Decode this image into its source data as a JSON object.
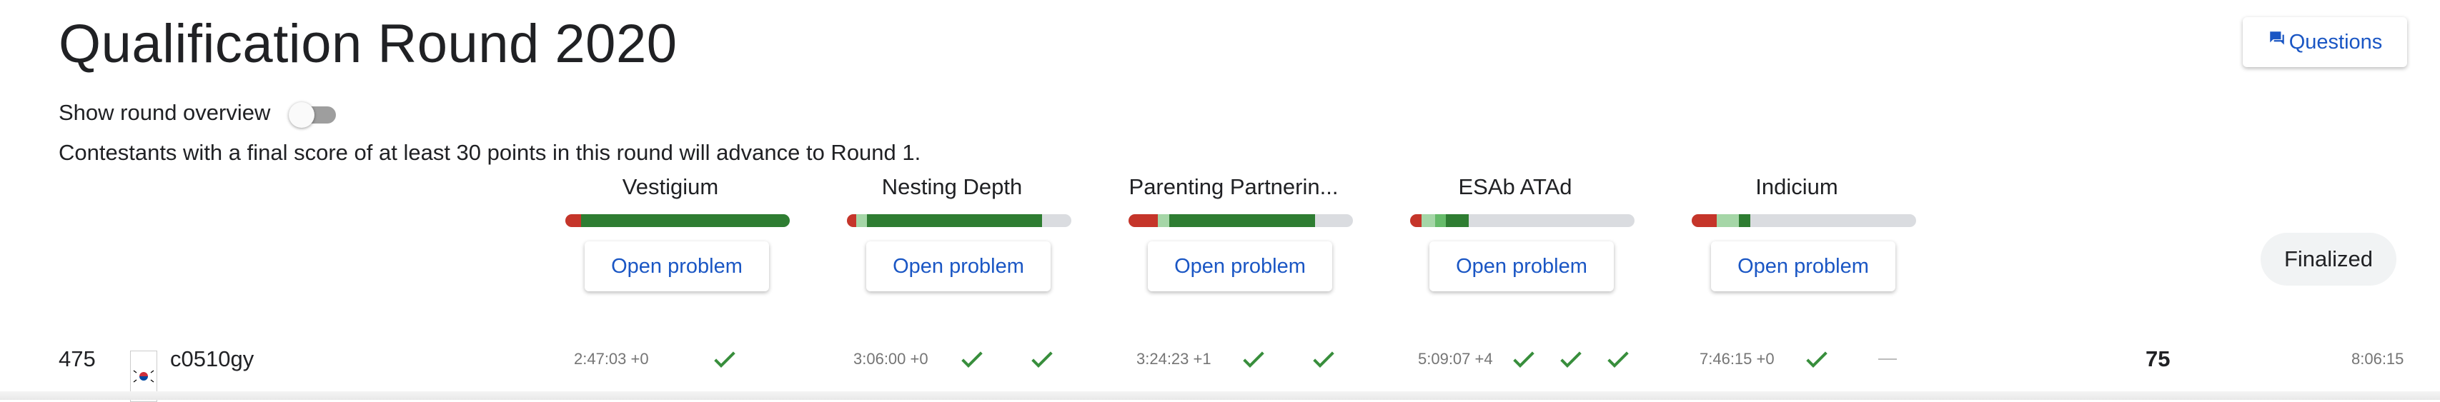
{
  "round": {
    "title": "Qualification Round 2020",
    "questions_label": "Questions",
    "overview_toggle_label": "Show round overview",
    "overview_toggle_on": false,
    "advance_text": "Contestants with a final score of at least 30 points in this round will advance to Round 1.",
    "status_label": "Finalized",
    "open_problem_label": "Open problem"
  },
  "problems": [
    {
      "name": "Vestigium",
      "bar": [
        {
          "color": "#c5352a",
          "frac": 0.07
        },
        {
          "color": "#2e7d32",
          "frac": 0.93
        }
      ]
    },
    {
      "name": "Nesting Depth",
      "bar": [
        {
          "color": "#c5352a",
          "frac": 0.04
        },
        {
          "color": "#a5d6a7",
          "frac": 0.05
        },
        {
          "color": "#2e7d32",
          "frac": 0.78
        }
      ]
    },
    {
      "name": "Parenting Partnerin...",
      "bar": [
        {
          "color": "#c5352a",
          "frac": 0.13
        },
        {
          "color": "#a5d6a7",
          "frac": 0.05
        },
        {
          "color": "#2e7d32",
          "frac": 0.65
        }
      ]
    },
    {
      "name": "ESAb ATAd",
      "bar": [
        {
          "color": "#c5352a",
          "frac": 0.05
        },
        {
          "color": "#a5d6a7",
          "frac": 0.06
        },
        {
          "color": "#66bb6a",
          "frac": 0.05
        },
        {
          "color": "#2e7d32",
          "frac": 0.1
        }
      ]
    },
    {
      "name": "Indicium",
      "bar": [
        {
          "color": "#c5352a",
          "frac": 0.11
        },
        {
          "color": "#a5d6a7",
          "frac": 0.1
        },
        {
          "color": "#2e7d32",
          "frac": 0.05
        }
      ]
    }
  ],
  "colors": {
    "accent": "#1a56c4",
    "check": "#388e3c"
  },
  "scoreboard": [
    {
      "rank": "475",
      "country_icon": "south-korea-flag-icon",
      "name": "c0510gy",
      "attempts": [
        {
          "time": "2:47:03 +0",
          "checks": 1
        },
        {
          "time": "3:06:00 +0",
          "checks": 2
        },
        {
          "time": "3:24:23 +1",
          "checks": 2
        },
        {
          "time": "5:09:07 +4",
          "checks": 3
        },
        {
          "time": "7:46:15 +0",
          "checks": 1,
          "unattempted": 1
        }
      ],
      "score": "75",
      "total_time": "8:06:15"
    }
  ]
}
